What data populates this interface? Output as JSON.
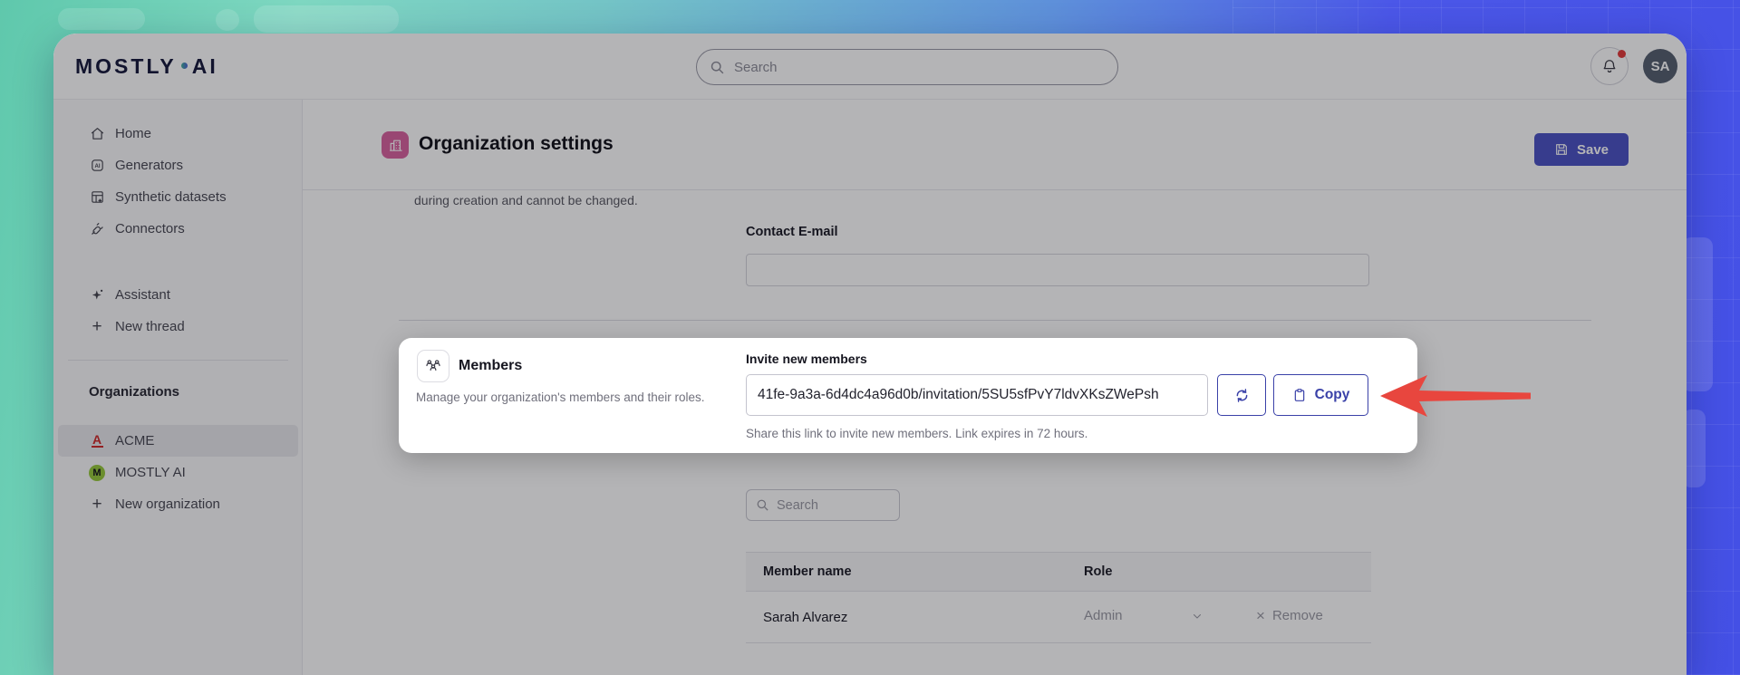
{
  "colors": {
    "accent_indigo": "#3a41a8",
    "save_button": "#4d54c4",
    "arrow_red": "#e8463e",
    "brand_navy": "#171b3d",
    "header_icon_pink": "#d9639f",
    "acme_red": "#d02c2c",
    "mostly_green": "#97c93d",
    "notification_red": "#e23b3b"
  },
  "icons": {
    "plus": "+",
    "close": "×"
  },
  "topbar": {
    "logo_part1": "MOSTLY",
    "logo_part2": "AI",
    "search_placeholder": "Search",
    "avatar_initials": "SA"
  },
  "sidebar": {
    "items": [
      {
        "icon": "home-icon",
        "label": "Home"
      },
      {
        "icon": "generators-icon",
        "label": "Generators"
      },
      {
        "icon": "synthetic-datasets-icon",
        "label": "Synthetic datasets"
      },
      {
        "icon": "connectors-icon",
        "label": "Connectors"
      }
    ],
    "assistant_items": [
      {
        "icon": "assistant-icon",
        "label": "Assistant"
      },
      {
        "icon": "plus-icon",
        "label": "New thread"
      }
    ],
    "organizations_heading": "Organizations",
    "organizations": [
      {
        "badge_letter": "A",
        "name": "ACME",
        "selected": true
      },
      {
        "badge_letter": "M",
        "name": "MOSTLY AI",
        "selected": false
      }
    ],
    "new_organization_label": "New organization"
  },
  "header": {
    "title": "Organization settings",
    "save_label": "Save"
  },
  "content": {
    "truncated_text": "during creation and cannot be changed.",
    "contact_email_label": "Contact E-mail",
    "contact_email_value": ""
  },
  "members_card": {
    "title": "Members",
    "description": "Manage your organization's members and their roles.",
    "invite_label": "Invite new members",
    "invite_link": "41fe-9a3a-6d4dc4a96d0b/invitation/5SU5sfPvY7ldvXKsZWePsh",
    "copy_label": "Copy",
    "share_hint": "Share this link to invite new members. Link expires in 72 hours."
  },
  "members_section": {
    "search_placeholder": "Search",
    "table": {
      "columns": [
        "Member name",
        "Role"
      ],
      "rows": [
        {
          "name": "Sarah Alvarez",
          "role": "Admin",
          "remove_label": "Remove"
        }
      ]
    }
  }
}
